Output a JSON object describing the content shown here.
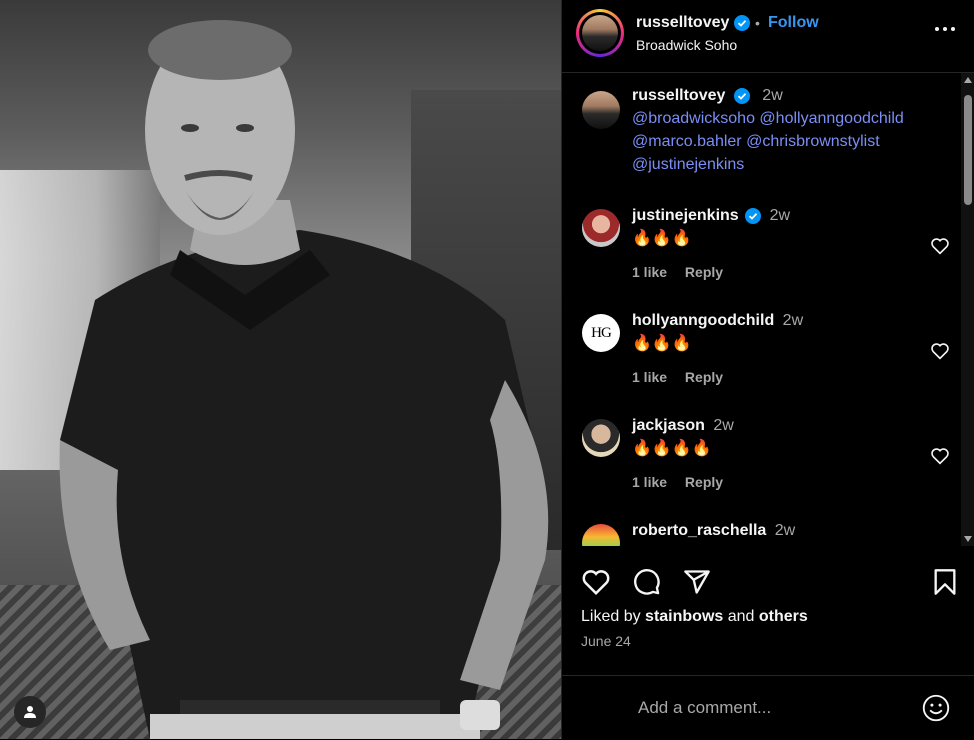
{
  "post": {
    "author": "russelltovey",
    "follow_label": "Follow",
    "location": "Broadwick Soho",
    "caption_time": "2w",
    "caption_mentions": [
      "@broadwicksoho",
      "@hollyanngoodchild",
      "@marco.bahler",
      "@chrisbrownstylist",
      "@justinejenkins"
    ]
  },
  "comments": [
    {
      "user": "justinejenkins",
      "verified": true,
      "time": "2w",
      "text": "🔥🔥🔥",
      "likes": "1 like",
      "reply": "Reply"
    },
    {
      "user": "hollyanngoodchild",
      "verified": false,
      "time": "2w",
      "text": "🔥🔥🔥",
      "likes": "1 like",
      "reply": "Reply",
      "avatar_text": "HG"
    },
    {
      "user": "jackjason",
      "verified": false,
      "time": "2w",
      "text": "🔥🔥🔥🔥",
      "likes": "1 like",
      "reply": "Reply"
    },
    {
      "user": "roberto_raschella",
      "verified": false,
      "time": "2w"
    }
  ],
  "liked_by": {
    "prefix": "Liked by",
    "user": "stainbows",
    "middle": "and",
    "others": "others"
  },
  "date": "June 24",
  "add_comment_placeholder": "Add a comment...",
  "colors": {
    "accent": "#3797f0",
    "mention": "#7b8ef5",
    "muted": "#a8a8a8",
    "verified": "#0095f6"
  }
}
